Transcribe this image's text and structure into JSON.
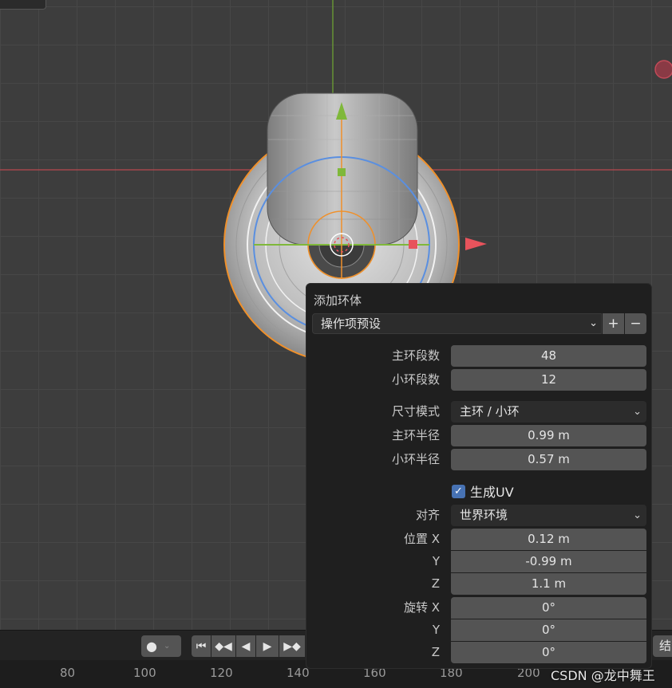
{
  "panel": {
    "title": "添加环体",
    "preset": {
      "label": "操作项预设",
      "add": "+",
      "remove": "−"
    },
    "major_segments": {
      "label": "主环段数",
      "value": "48"
    },
    "minor_segments": {
      "label": "小环段数",
      "value": "12"
    },
    "dimensions_mode": {
      "label": "尺寸模式",
      "value": "主环 / 小环"
    },
    "major_radius": {
      "label": "主环半径",
      "value": "0.99 m"
    },
    "minor_radius": {
      "label": "小环半径",
      "value": "0.57 m"
    },
    "generate_uv": {
      "label": "生成UV",
      "checked": true
    },
    "align": {
      "label": "对齐",
      "value": "世界环境"
    },
    "location": {
      "label": "位置 X",
      "y_label": "Y",
      "z_label": "Z",
      "x": "0.12 m",
      "y": "-0.99 m",
      "z": "1.1 m"
    },
    "rotation": {
      "label": "旋转 X",
      "y_label": "Y",
      "z_label": "Z",
      "x": "0°",
      "y": "0°",
      "z": "0°"
    }
  },
  "timeline": {
    "ticks": [
      "80",
      "100",
      "120",
      "140",
      "160",
      "180",
      "200"
    ],
    "right_stub": "结"
  },
  "watermark": "CSDN @龙中舞王",
  "colors": {
    "x_axis": "#c84a4a",
    "y_axis": "#7fb83a",
    "selection": "#f0902a",
    "gizmo_blue": "#5a8fe0",
    "checkbox": "#4772b3"
  },
  "icons": {
    "record": "record-icon",
    "jump_start": "jump-start-icon",
    "prev_keyframe": "prev-keyframe-icon",
    "play_reverse": "play-reverse-icon",
    "play": "play-icon",
    "next_keyframe": "next-keyframe-icon"
  }
}
